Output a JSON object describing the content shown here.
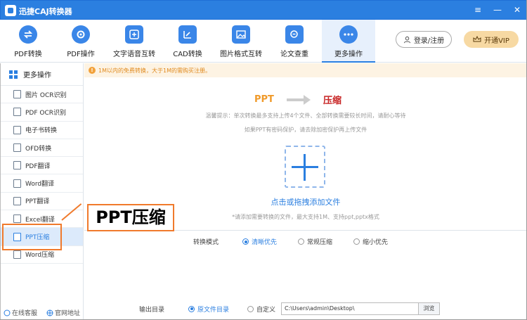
{
  "app": {
    "title": "迅捷CAJ转换器"
  },
  "window": {
    "menu_icon": "≡",
    "minimize_icon": "—",
    "close_icon": "✕"
  },
  "toolbar": {
    "items": [
      {
        "label": "PDF转换"
      },
      {
        "label": "PDF操作"
      },
      {
        "label": "文字语音互转"
      },
      {
        "label": "CAD转换"
      },
      {
        "label": "图片格式互转"
      },
      {
        "label": "论文查重"
      },
      {
        "label": "更多操作"
      }
    ],
    "login_label": "登录/注册",
    "vip_label": "开通VIP",
    "accent": "#2b7fe0"
  },
  "sidebar": {
    "header": "更多操作",
    "items": [
      {
        "label": "图片 OCR识别"
      },
      {
        "label": "PDF OCR识别"
      },
      {
        "label": "电子书转换"
      },
      {
        "label": "OFD转换"
      },
      {
        "label": "PDF翻译"
      },
      {
        "label": "Word翻译"
      },
      {
        "label": "PPT翻译"
      },
      {
        "label": "Excel翻译"
      },
      {
        "label": "PPT压缩"
      },
      {
        "label": "Word压缩"
      }
    ],
    "footer_service": "在线客服",
    "footer_site": "官网地址"
  },
  "notice": {
    "icon": "!",
    "text": "1M以内的免费转换，大于1M的需购买注册。"
  },
  "main": {
    "source_format": "PPT",
    "target_action": "压缩",
    "tip_line1": "温馨提示：单次转换最多支持上传4个文件、全部转换需要较长时间，请耐心等待",
    "tip_line2": "如果PPT有密码保护，请去除加密保护再上传文件",
    "add_label": "点击或拖拽添加文件",
    "add_hint": "*请添加需要转换的文件，最大支持1M、支持ppt,pptx格式"
  },
  "mode": {
    "label": "转换模式",
    "options": [
      {
        "label": "清晰优先",
        "selected": true
      },
      {
        "label": "常规压缩",
        "selected": false
      },
      {
        "label": "缩小优先",
        "selected": false
      }
    ]
  },
  "output": {
    "label": "输出目录",
    "options": [
      {
        "label": "原文件目录",
        "selected": true
      },
      {
        "label": "自定义",
        "selected": false
      }
    ],
    "path": "C:\\Users\\admin\\Desktop\\",
    "browse_label": "浏览"
  },
  "annotation": {
    "label": "PPT压缩",
    "color": "#f07a2c"
  }
}
